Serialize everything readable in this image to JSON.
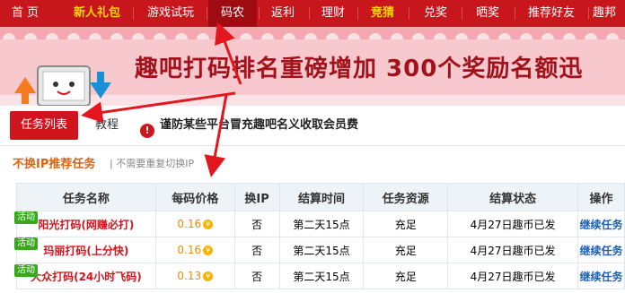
{
  "nav": {
    "items": [
      {
        "label": "首 页"
      },
      {
        "label": "新人礼包"
      },
      {
        "label": "游戏试玩"
      },
      {
        "label": "码农"
      },
      {
        "label": "返利"
      },
      {
        "label": "理财"
      },
      {
        "label": "竞猜"
      },
      {
        "label": "兑奖"
      },
      {
        "label": "晒奖"
      },
      {
        "label": "推荐好友"
      },
      {
        "label": "趣邦"
      }
    ],
    "active_index": 3,
    "bg_color": "#c8161d"
  },
  "banner": {
    "text": "趣吧打码排名重磅增加 300个奖励名额迅"
  },
  "tabs": {
    "active_label": "任务列表",
    "tutorial_label": "教程",
    "notice_icon": "warning-icon",
    "notice": "谨防某些平台冒充趣吧名义收取会员费"
  },
  "section": {
    "title": "不换IP推荐任务",
    "subtitle": "| 不需要重复切换IP"
  },
  "table": {
    "headers": [
      "任务名称",
      "每码价格",
      "换IP",
      "结算时间",
      "任务资源",
      "结算状态",
      "操作"
    ],
    "rows": [
      {
        "badge": "活动",
        "name": "阳光打码(网赚必打)",
        "price": "0.16",
        "ip": "否",
        "settle_time": "第二天15点",
        "resource": "充足",
        "status": "4月27日趣币已发",
        "action": "继续任务"
      },
      {
        "badge": "活动",
        "name": "玛丽打码(上分快)",
        "price": "0.16",
        "ip": "否",
        "settle_time": "第二天15点",
        "resource": "充足",
        "status": "4月27日趣币已发",
        "action": "继续任务"
      },
      {
        "badge": "活动",
        "name": "大众打码(24小时飞码)",
        "price": "0.13",
        "ip": "否",
        "settle_time": "第二天15点",
        "resource": "充足",
        "status": "4月27日趣币已发",
        "action": "继续任务"
      }
    ],
    "coin_glyph": "¥"
  }
}
